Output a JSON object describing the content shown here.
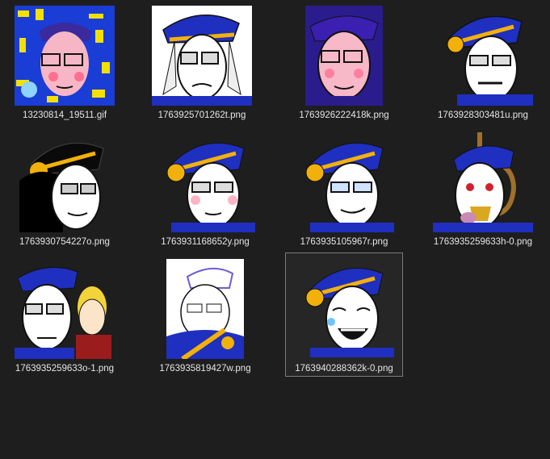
{
  "files": [
    {
      "name": "13230814_19511.gif",
      "thumb": "collage"
    },
    {
      "name": "1763925701262t.png",
      "thumb": "sad-white"
    },
    {
      "name": "1763926222418k.png",
      "thumb": "pink"
    },
    {
      "name": "1763928303481u.png",
      "thumb": "grimace"
    },
    {
      "name": "1763930754227o.png",
      "thumb": "black-white"
    },
    {
      "name": "1763931168652y.png",
      "thumb": "blush"
    },
    {
      "name": "1763935105967r.png",
      "thumb": "smirk"
    },
    {
      "name": "1763935259633h-0.png",
      "thumb": "noose"
    },
    {
      "name": "1763935259633o-1.png",
      "thumb": "duo"
    },
    {
      "name": "1763935819427w.png",
      "thumb": "lineart"
    },
    {
      "name": "1763940288362k-0.png",
      "thumb": "laugh",
      "selected": true
    }
  ],
  "colors": {
    "background": "#1e1e1e",
    "label_text": "#e6e6e6",
    "selection_border": "#7a7a7a",
    "hat_blue": "#1f2fbf",
    "hat_gold": "#f2b10a"
  }
}
